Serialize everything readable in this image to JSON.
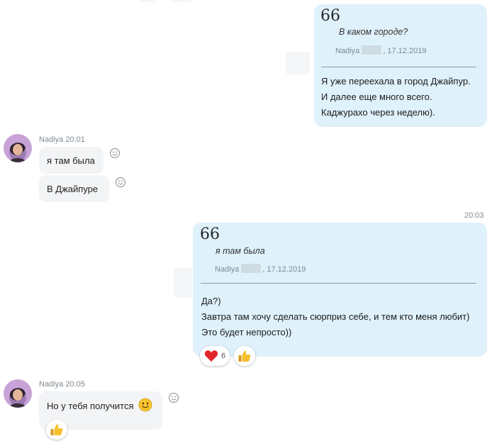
{
  "messages": [
    {
      "direction": "outgoing",
      "quote": {
        "mark": "66",
        "text": "В каком городе?",
        "author": "Nadiya",
        "date": "17.12.2019"
      },
      "lines": [
        "Я уже переехала в город Джайпур.",
        "И далее еще много всего.",
        "Каджурахо через неделю)."
      ]
    },
    {
      "direction": "incoming",
      "sender": "Nadiya",
      "time": "20:01",
      "bubbles": [
        "я там была",
        "В Джайпуре"
      ]
    },
    {
      "direction": "outgoing",
      "time": "20:03",
      "quote": {
        "mark": "66",
        "text": "я там была",
        "author": "Nadiya",
        "date": "17.12.2019"
      },
      "lines": [
        "Да?)",
        "Завтра там хочу сделать сюрприз себе, и тем кто меня любит)",
        "Это будет непросто))"
      ],
      "reactions": [
        {
          "icon": "heart-icon",
          "count": "6"
        },
        {
          "icon": "thumbs-up-icon",
          "count": ""
        }
      ]
    },
    {
      "direction": "incoming",
      "sender": "Nadiya",
      "time": "20:05",
      "text": "Но у тебя получится",
      "emoji": "smiley-icon",
      "reactions": [
        {
          "icon": "thumbs-up-icon",
          "count": ""
        }
      ]
    }
  ],
  "colors": {
    "outgoing_bubble": "#dff1fb",
    "incoming_bubble": "#f2f4f6",
    "meta_text": "#7e8a93"
  }
}
